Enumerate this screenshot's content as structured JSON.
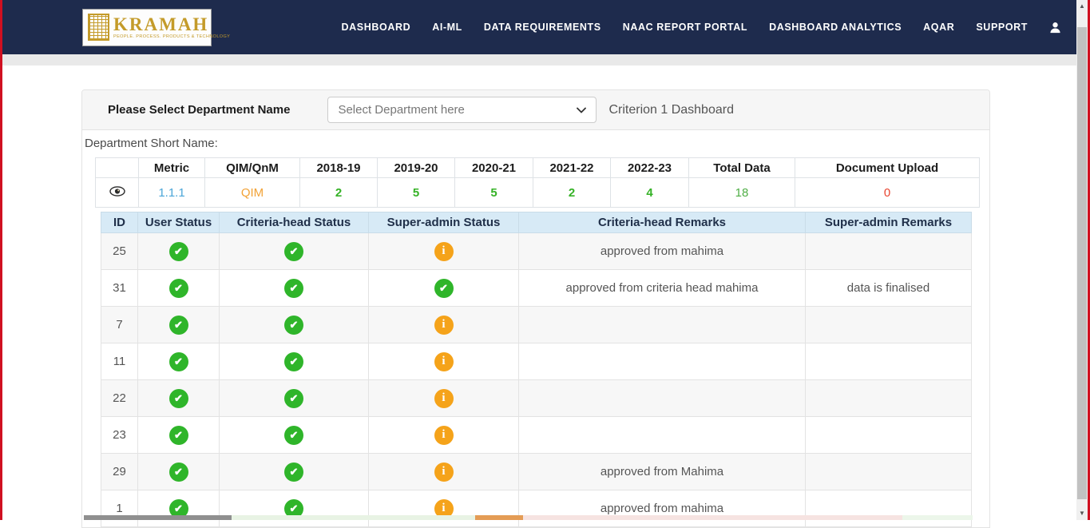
{
  "navbar": {
    "logo": {
      "title": "KRAMAH",
      "tagline": "PEOPLE. PROCESS. PRODUCTS & TECHNOLOGY"
    },
    "items": [
      {
        "label": "DASHBOARD"
      },
      {
        "label": "AI-ML"
      },
      {
        "label": "DATA REQUIREMENTS"
      },
      {
        "label": "NAAC REPORT PORTAL"
      },
      {
        "label": "DASHBOARD ANALYTICS"
      },
      {
        "label": "AQAR"
      },
      {
        "label": "SUPPORT"
      }
    ]
  },
  "filter": {
    "label": "Please Select Department Name",
    "select_value": "Select Department here",
    "dashboard_title": "Criterion 1 Dashboard"
  },
  "department_short_name_label": "Department Short Name:",
  "metric_table": {
    "headers": [
      "",
      "Metric",
      "QIM/QnM",
      "2018-19",
      "2019-20",
      "2020-21",
      "2021-22",
      "2022-23",
      "Total Data",
      "Document Upload"
    ],
    "row": {
      "metric": "1.1.1",
      "qim_qnm": "QIM",
      "y2018_19": "2",
      "y2019_20": "5",
      "y2020_21": "5",
      "y2021_22": "2",
      "y2022_23": "4",
      "total_data": "18",
      "document_upload": "0"
    }
  },
  "status_table": {
    "headers": [
      "ID",
      "User Status",
      "Criteria-head Status",
      "Super-admin Status",
      "Criteria-head Remarks",
      "Super-admin Remarks"
    ],
    "rows": [
      {
        "id": "25",
        "user_status": "check",
        "criteria_head_status": "check",
        "super_admin_status": "info",
        "criteria_head_remarks": "approved from mahima",
        "super_admin_remarks": ""
      },
      {
        "id": "31",
        "user_status": "check",
        "criteria_head_status": "check",
        "super_admin_status": "check",
        "criteria_head_remarks": "approved from criteria head mahima",
        "super_admin_remarks": "data is finalised"
      },
      {
        "id": "7",
        "user_status": "check",
        "criteria_head_status": "check",
        "super_admin_status": "info",
        "criteria_head_remarks": "",
        "super_admin_remarks": ""
      },
      {
        "id": "11",
        "user_status": "check",
        "criteria_head_status": "check",
        "super_admin_status": "info",
        "criteria_head_remarks": "",
        "super_admin_remarks": ""
      },
      {
        "id": "22",
        "user_status": "check",
        "criteria_head_status": "check",
        "super_admin_status": "info",
        "criteria_head_remarks": "",
        "super_admin_remarks": ""
      },
      {
        "id": "23",
        "user_status": "check",
        "criteria_head_status": "check",
        "super_admin_status": "info",
        "criteria_head_remarks": "",
        "super_admin_remarks": ""
      },
      {
        "id": "29",
        "user_status": "check",
        "criteria_head_status": "check",
        "super_admin_status": "info",
        "criteria_head_remarks": "approved from Mahima",
        "super_admin_remarks": ""
      },
      {
        "id": "1",
        "user_status": "check",
        "criteria_head_status": "check",
        "super_admin_status": "info",
        "criteria_head_remarks": "approved from mahima",
        "super_admin_remarks": ""
      }
    ]
  },
  "colors": {
    "navbar_bg": "#1e2b4d",
    "brand_gold": "#c49b2a",
    "frame_red": "#d01021",
    "status_check_green": "#2fb52a",
    "status_info_orange": "#f5a31a",
    "metric_link_blue": "#4ba6d8",
    "qim_orange": "#f2a236",
    "year_green": "#35b226",
    "doc_upload_red": "#e8442f",
    "table_header_blue": "#d7eaf6"
  }
}
